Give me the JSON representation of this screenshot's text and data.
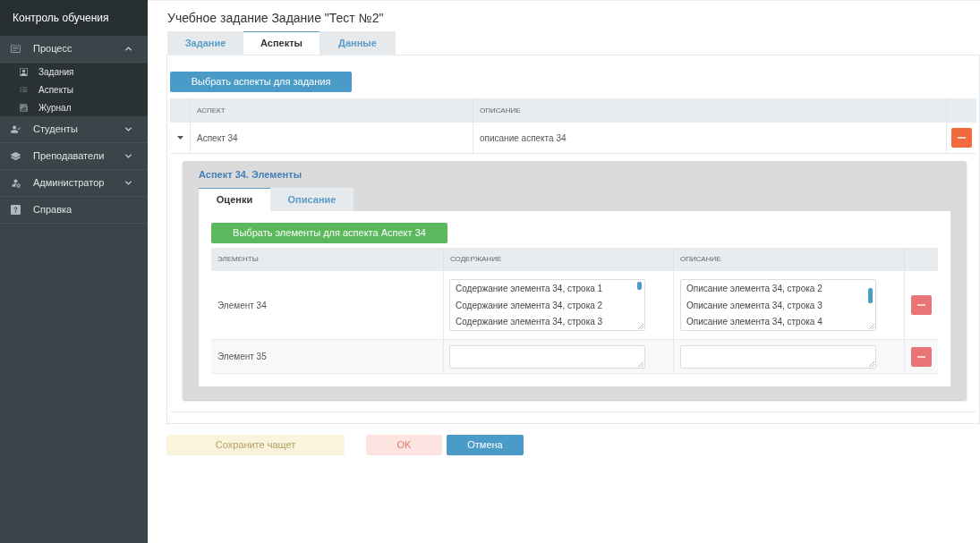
{
  "sidebar": {
    "title": "Контроль обучения",
    "items": [
      {
        "label": "Процесс",
        "expanded": true,
        "children": [
          {
            "label": "Задания"
          },
          {
            "label": "Аспекты"
          },
          {
            "label": "Журнал"
          }
        ]
      },
      {
        "label": "Студенты",
        "expanded": false
      },
      {
        "label": "Преподаватели",
        "expanded": false
      },
      {
        "label": "Администратор",
        "expanded": false
      },
      {
        "label": "Справка"
      }
    ]
  },
  "page": {
    "title": "Учебное задание Задание \"Тест №2\"",
    "tabs": [
      {
        "label": "Задание",
        "selected": false
      },
      {
        "label": "Аспекты",
        "selected": true
      },
      {
        "label": "Данные",
        "selected": false
      }
    ],
    "select_button": "Выбрать аспекты для задания",
    "table": {
      "columns": [
        "АСПЕКТ",
        "ОПИСАНИЕ"
      ],
      "rows": [
        {
          "aspect": "Аспект 34",
          "description": "описание аспекта 34",
          "expanded": true,
          "details": {
            "title": "Аспект 34. Элементы",
            "tabs": [
              {
                "label": "Оценки",
                "selected": true
              },
              {
                "label": "Описание",
                "selected": false
              }
            ],
            "select_button": "Выбрать элементы для аспекта Аспект 34",
            "table": {
              "columns": [
                "ЭЛЕМЕНТЫ",
                "СОДЕРЖАНИЕ",
                "ОПИСАНИЕ"
              ],
              "rows": [
                {
                  "element": "Элемент 34",
                  "content": [
                    "Содержание элемента 34, строка 1",
                    "Содержание элемента 34, строка 2",
                    "Содержание элемента 34, строка 3"
                  ],
                  "description": [
                    "Описание элемента 34, строка 2",
                    "Описание элемента 34, строка 3",
                    "Описание элемента 34, строка 4"
                  ]
                },
                {
                  "element": "Элемент 35"
                }
              ]
            }
          }
        }
      ]
    }
  },
  "buttons": [
    {
      "label": "Сохраните чащет",
      "kind": "warning",
      "disabled": true
    },
    {
      "label": "OK",
      "kind": "danger",
      "disabled": true
    },
    {
      "label": "Отмена",
      "kind": "primary",
      "disabled": false
    }
  ]
}
